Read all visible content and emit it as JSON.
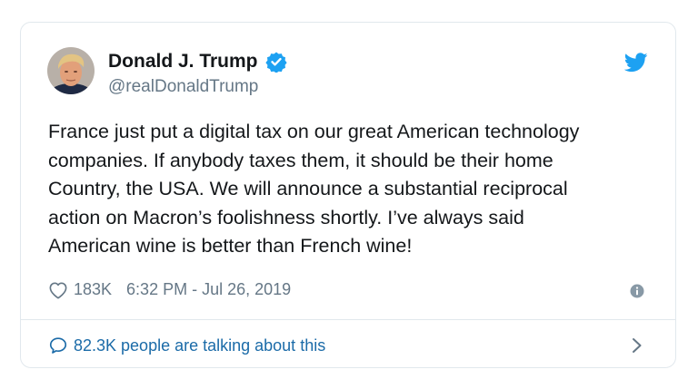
{
  "author": {
    "name": "Donald J. Trump",
    "handle": "@realDonaldTrump",
    "verified": true
  },
  "tweet": {
    "text": "France just put a digital tax on our great American technology\ncompanies. If anybody taxes them, it should be their home\nCountry, the USA. We will announce a substantial reciprocal\naction on Macron’s foolishness shortly. I’ve always said\nAmerican wine is better than French wine!",
    "likes": "183K",
    "timestamp": "6:32 PM - Jul 26, 2019"
  },
  "footer": {
    "talking_label": "82.3K people are talking about this"
  },
  "icons": {
    "bird": "twitter-bird-icon",
    "verified": "verified-badge-icon",
    "like": "heart-icon",
    "info": "info-icon",
    "reply": "speech-bubble-icon",
    "chevron": "chevron-right-icon"
  },
  "colors": {
    "brand": "#1da1f2",
    "link": "#1b6ba8",
    "secondary_text": "#657786",
    "border": "#e1e8ed"
  }
}
